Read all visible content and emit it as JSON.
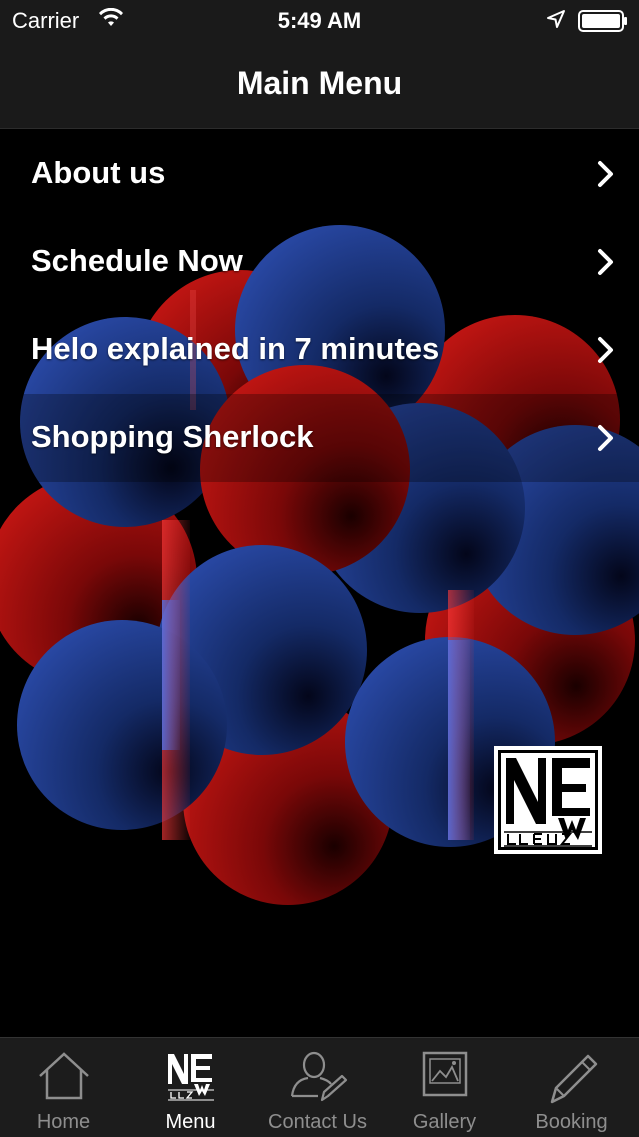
{
  "status_bar": {
    "carrier": "Carrier",
    "time": "5:49 AM",
    "icons": [
      "wifi-icon",
      "location-arrow-icon",
      "battery-icon"
    ]
  },
  "nav_bar": {
    "title": "Main Menu"
  },
  "menu": {
    "items": [
      {
        "label": "About us",
        "icon": "chevron-right-icon"
      },
      {
        "label": "Schedule Now",
        "icon": "chevron-right-icon"
      },
      {
        "label": "Helo explained in 7 minutes",
        "icon": "chevron-right-icon"
      },
      {
        "label": "Shopping Sherlock",
        "icon": "chevron-right-icon"
      }
    ]
  },
  "logo": {
    "text": "NEW CLEUS"
  },
  "tab_bar": {
    "tabs": [
      {
        "label": "Home",
        "icon": "home-icon",
        "active": false
      },
      {
        "label": "Menu",
        "icon": "newcleus-logo-icon",
        "active": true
      },
      {
        "label": "Contact Us",
        "icon": "contact-person-icon",
        "active": false
      },
      {
        "label": "Gallery",
        "icon": "gallery-picture-icon",
        "active": false
      },
      {
        "label": "Booking",
        "icon": "pencil-icon",
        "active": false
      }
    ]
  },
  "colors": {
    "bar_background": "#1a1a1a",
    "page_background": "#000000",
    "text_active": "#ffffff",
    "text_inactive": "#8e8e8e",
    "sphere_red": "#b51210",
    "sphere_blue": "#1f3f9a"
  }
}
